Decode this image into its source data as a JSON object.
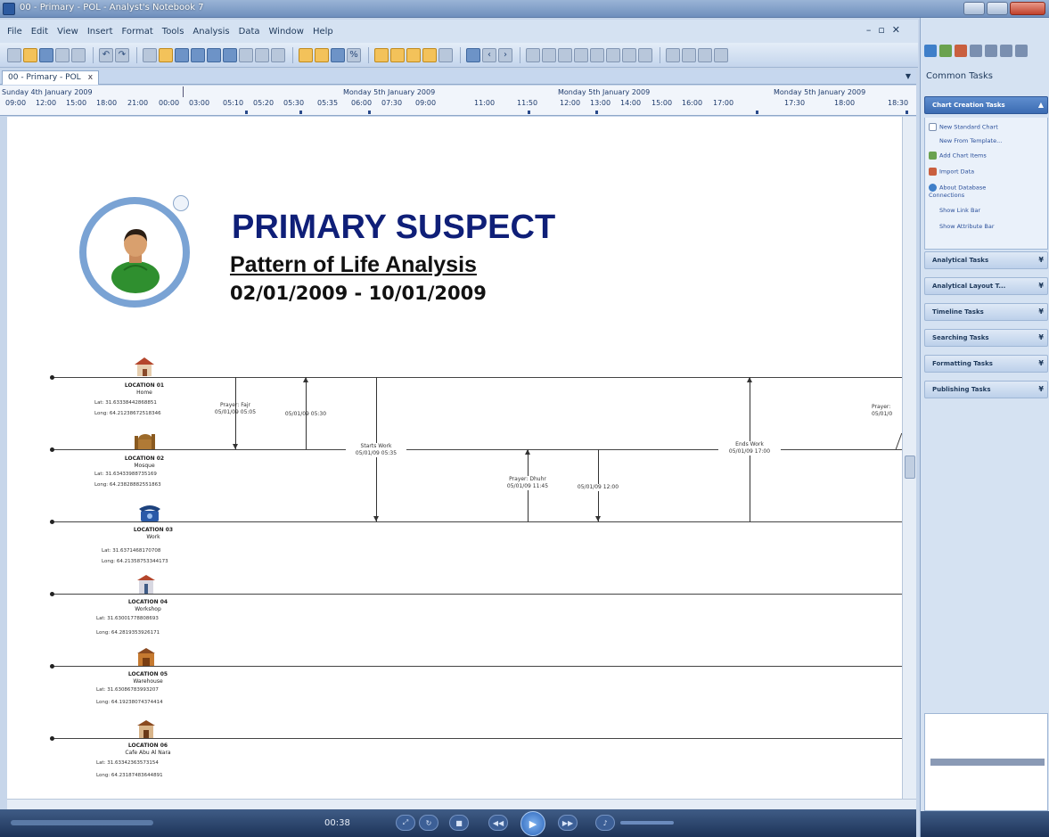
{
  "window": {
    "title": "00 - Primary - POL - Analyst's Notebook 7"
  },
  "menu": [
    "File",
    "Edit",
    "View",
    "Insert",
    "Format",
    "Tools",
    "Analysis",
    "Data",
    "Window",
    "Help"
  ],
  "doc_tab": {
    "label": "00 - Primary - POL",
    "close": "x"
  },
  "ruler": {
    "days": [
      "Sunday 4th January 2009",
      "Monday 5th January 2009",
      "Monday 5th January 2009",
      "Monday 5th January 2009"
    ],
    "times": [
      "09:00",
      "12:00",
      "15:00",
      "18:00",
      "21:00",
      "00:00",
      "03:00",
      "05:10",
      "05:20",
      "05:30",
      "05:35",
      "06:00",
      "07:30",
      "09:00",
      "11:00",
      "11:50",
      "12:00",
      "13:00",
      "14:00",
      "15:00",
      "16:00",
      "17:00",
      "17:30",
      "18:00",
      "18:30"
    ]
  },
  "chart": {
    "title": "PRIMARY SUSPECT",
    "subtitle": "Pattern of Life Analysis",
    "date_range": "02/01/2009 - 10/01/2009"
  },
  "locations": [
    {
      "id": "LOCATION 01",
      "name": "Home",
      "lat": "Lat:  31.63338442868851",
      "long": "Long:  64.21238672518346"
    },
    {
      "id": "LOCATION 02",
      "name": "Mosque",
      "lat": "Lat:  31.63433988735169",
      "long": "Long:  64.23828882551863"
    },
    {
      "id": "LOCATION 03",
      "name": "Work",
      "lat": "Lat:  31.6371468170708",
      "long": "Long:  64.21358753344173"
    },
    {
      "id": "LOCATION 04",
      "name": "Workshop",
      "lat": "Lat:  31.63001778808693",
      "long": "Long:  64.2819353926171"
    },
    {
      "id": "LOCATION 05",
      "name": "Warehouse",
      "lat": "Lat:  31.63086783993207",
      "long": "Long:  64.19238074374414"
    },
    {
      "id": "LOCATION 06",
      "name": "Cafe Abu Al Nara",
      "lat": "Lat:  31.63342363573154",
      "long": "Long:  64.23187483644891"
    }
  ],
  "events": [
    {
      "name": "Prayer: Fajr",
      "time": "05/01/09 05:05"
    },
    {
      "name": "",
      "time": "05/01/09 05:30"
    },
    {
      "name": "Starts Work",
      "time": "05/01/09 05:35"
    },
    {
      "name": "Prayer: Dhuhr",
      "time": "05/01/09 11:45"
    },
    {
      "name": "",
      "time": "05/01/09 12:00"
    },
    {
      "name": "Ends Work",
      "time": "05/01/09 17:00"
    },
    {
      "name": "Prayer:",
      "time": "05/01/0"
    }
  ],
  "task_pane": {
    "title": "Common Tasks",
    "active_section": "Chart Creation Tasks",
    "tasks": [
      "New Standard Chart",
      "New From Template...",
      "Add Chart Items",
      "Import Data",
      "About Database Connections",
      "Show Link Bar",
      "Show Attribute Bar"
    ],
    "sections": [
      "Analytical Tasks",
      "Analytical Layout T...",
      "Timeline Tasks",
      "Searching Tasks",
      "Formatting Tasks",
      "Publishing Tasks"
    ]
  },
  "player": {
    "time": "00:38"
  },
  "icons": {
    "avatar": "person-icon",
    "home": "house-icon",
    "mosque": "mosque-icon",
    "work": "phone-icon",
    "workshop": "building-icon",
    "warehouse": "warehouse-icon",
    "cafe": "cafe-icon"
  },
  "colors": {
    "title_blue": "#0f1f78",
    "ring_blue": "#7aa3d4",
    "active_section": "#3b6bb2"
  }
}
